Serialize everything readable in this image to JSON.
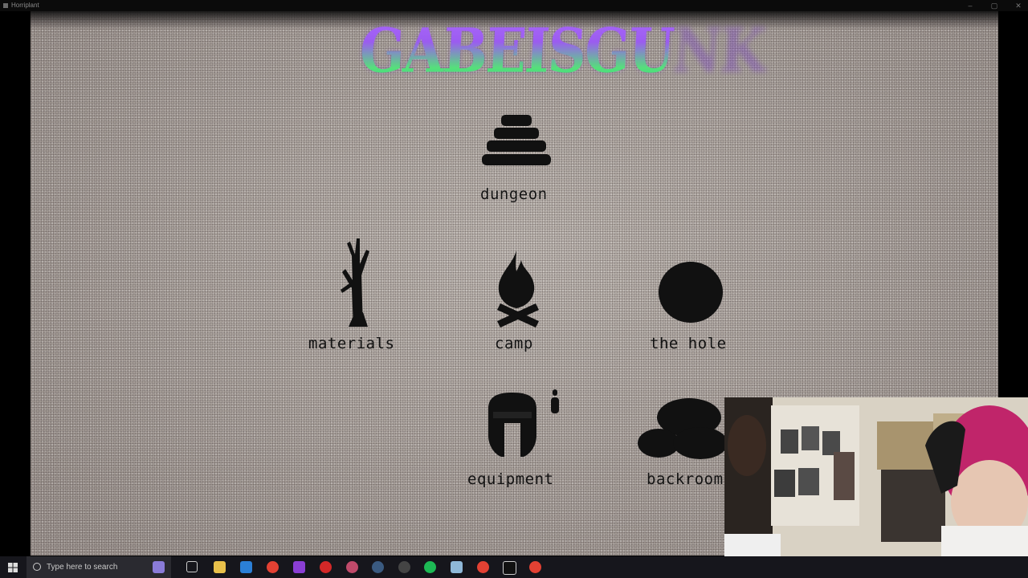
{
  "window": {
    "title": "Horriplant"
  },
  "game": {
    "logo_text": "GABEISGUNK",
    "menu": [
      {
        "id": "dungeon",
        "label": "dungeon"
      },
      {
        "id": "materials",
        "label": "materials"
      },
      {
        "id": "camp",
        "label": "camp"
      },
      {
        "id": "the-hole",
        "label": "the hole"
      },
      {
        "id": "equipment",
        "label": "equipment"
      },
      {
        "id": "backrooms",
        "label": "backroom"
      }
    ]
  },
  "taskbar": {
    "search_placeholder": "Type here to search",
    "pinned_icons": [
      "clapper-icon",
      "task-view-icon",
      "file-explorer-icon",
      "edge-icon",
      "chrome-icon",
      "twitch-icon",
      "opera-icon",
      "chrome-profile-icon",
      "steam-icon",
      "obs-icon",
      "spotify-icon",
      "notepad-icon",
      "chrome-icon",
      "terminal-icon",
      "chrome-icon"
    ]
  },
  "colors": {
    "paper": "#b6aea7",
    "ink": "#121212",
    "logo_top": "#b06cff",
    "logo_bottom": "#2bd08a",
    "taskbar": "#16161c"
  }
}
